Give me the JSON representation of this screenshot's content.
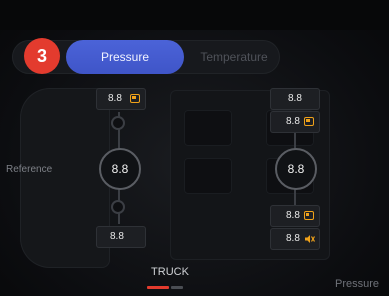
{
  "step_badge": "3",
  "tabs": [
    {
      "label": "Pressure",
      "active": true
    },
    {
      "label": "Temperature",
      "active": false
    }
  ],
  "reference_label": "Reference",
  "axles": {
    "front": "8.8",
    "rear": "8.8"
  },
  "tires": {
    "front_left": {
      "value": "8.8",
      "icon": "warning-battery-icon"
    },
    "rear_left": {
      "value": "8.8"
    },
    "front_right_outer": {
      "value": "8.8"
    },
    "front_right_inner": {
      "value": "8.8",
      "icon": "warning-battery-icon"
    },
    "rear_right_inner": {
      "value": "8.8",
      "icon": "warning-battery-half-icon"
    },
    "rear_right_outer": {
      "value": "8.8",
      "icon": "sound-muted-icon"
    }
  },
  "vehicle_tab": "TRUCK",
  "corner_label": "Pressure",
  "colors": {
    "accent": "#4b63d8",
    "badge": "#e33b2e",
    "warning": "#f0a21a"
  }
}
